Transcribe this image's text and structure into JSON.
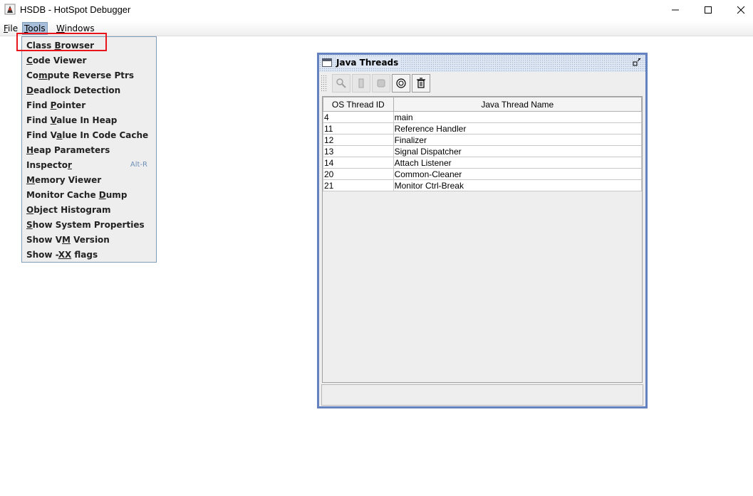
{
  "window": {
    "title": "HSDB - HotSpot Debugger",
    "controls": [
      "minimize",
      "maximize",
      "close"
    ]
  },
  "menubar": {
    "items": [
      {
        "label_mn": "F",
        "label_rest": "ile"
      },
      {
        "label_mn": "T",
        "label_rest": "ools"
      },
      {
        "label_mn": "W",
        "label_rest": "indows"
      }
    ]
  },
  "tools_menu": {
    "items": [
      {
        "pre": "Class ",
        "mn": "B",
        "post": "rowser"
      },
      {
        "pre": "",
        "mn": "C",
        "post": "ode Viewer"
      },
      {
        "pre": "Co",
        "mn": "m",
        "post": "pute Reverse Ptrs"
      },
      {
        "pre": "",
        "mn": "D",
        "post": "eadlock Detection"
      },
      {
        "pre": "Find ",
        "mn": "P",
        "post": "ointer"
      },
      {
        "pre": "Find ",
        "mn": "V",
        "post": "alue In Heap"
      },
      {
        "pre": "Find V",
        "mn": "a",
        "post": "lue In Code Cache"
      },
      {
        "pre": "",
        "mn": "H",
        "post": "eap Parameters"
      },
      {
        "pre": "Inspecto",
        "mn": "r",
        "post": "",
        "accelerator": "Alt-R"
      },
      {
        "pre": "",
        "mn": "M",
        "post": "emory Viewer"
      },
      {
        "pre": "Monitor Cache ",
        "mn": "D",
        "post": "ump"
      },
      {
        "pre": "",
        "mn": "O",
        "post": "bject Histogram"
      },
      {
        "pre": "",
        "mn": "S",
        "post": "how System Properties"
      },
      {
        "pre": "Show V",
        "mn": "M",
        "post": " Version"
      },
      {
        "pre": "Show -",
        "mn": "XX",
        "post": " flags"
      }
    ]
  },
  "java_threads": {
    "title": "Java Threads",
    "toolbar": [
      "inspect-icon",
      "stack-memory-icon",
      "stop-icon",
      "finder-icon",
      "delete-icon"
    ],
    "columns": [
      "OS Thread ID",
      "Java Thread Name"
    ],
    "rows": [
      [
        "4",
        "main"
      ],
      [
        "11",
        "Reference Handler"
      ],
      [
        "12",
        "Finalizer"
      ],
      [
        "13",
        "Signal Dispatcher"
      ],
      [
        "14",
        "Attach Listener"
      ],
      [
        "20",
        "Common-Cleaner"
      ],
      [
        "21",
        "Monitor Ctrl-Break"
      ]
    ]
  },
  "colors": {
    "highlight": "#e8141b",
    "frame_border": "#6382bf",
    "menu_active": "#a8bfdc"
  }
}
